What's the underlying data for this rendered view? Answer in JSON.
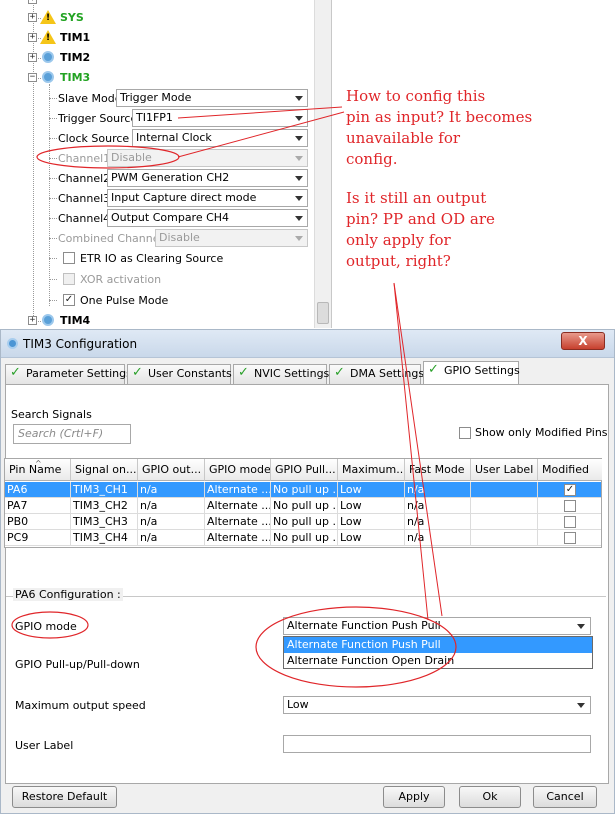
{
  "tree": {
    "items": [
      {
        "label": "SYS",
        "icon": "warning-icon",
        "color": "#22a322"
      },
      {
        "label": "TIM1",
        "icon": "warning-icon",
        "color": "#000000"
      },
      {
        "label": "TIM2",
        "icon": "gear-icon",
        "color": "#000000"
      },
      {
        "label": "TIM3",
        "icon": "gear-icon",
        "color": "#22a322"
      },
      {
        "label": "TIM4",
        "icon": "gear-icon",
        "color": "#000000"
      }
    ],
    "tim3_props": [
      {
        "label": "Slave Mode",
        "value": "Trigger Mode",
        "enabled": true
      },
      {
        "label": "Trigger Source",
        "value": "TI1FP1",
        "enabled": true
      },
      {
        "label": "Clock Source",
        "value": "Internal Clock",
        "enabled": true
      },
      {
        "label": "Channel1",
        "value": "Disable",
        "enabled": false
      },
      {
        "label": "Channel2",
        "value": "PWM Generation CH2",
        "enabled": true
      },
      {
        "label": "Channel3",
        "value": "Input Capture direct mode",
        "enabled": true
      },
      {
        "label": "Channel4",
        "value": "Output Compare CH4",
        "enabled": true
      },
      {
        "label": "Combined Channels",
        "value": "Disable",
        "enabled": false
      }
    ],
    "checks": [
      {
        "label": "ETR IO as Clearing Source",
        "checked": false,
        "enabled": true
      },
      {
        "label": "XOR activation",
        "checked": false,
        "enabled": false
      },
      {
        "label": "One Pulse Mode",
        "checked": true,
        "enabled": true
      }
    ]
  },
  "notes": {
    "first": [
      "How to config this",
      "pin as input?  It becomes",
      "unavailable for",
      "config."
    ],
    "second": [
      "Is it still an output",
      "pin?  PP and OD are",
      "only apply for",
      "output, right?"
    ]
  },
  "dialog": {
    "title": "TIM3 Configuration",
    "close_label": "X",
    "tabs": [
      {
        "label": "Parameter Settings"
      },
      {
        "label": "User Constants"
      },
      {
        "label": "NVIC Settings"
      },
      {
        "label": "DMA Settings"
      },
      {
        "label": "GPIO Settings",
        "active": true
      }
    ],
    "search": {
      "label": "Search Signals",
      "placeholder": "Search (Crtl+F)"
    },
    "only_modified_label": "Show only Modified Pins",
    "table": {
      "columns": [
        "Pin Name",
        "Signal on...",
        "GPIO out...",
        "GPIO mode",
        "GPIO Pull...",
        "Maximum...",
        "Fast Mode",
        "User Label",
        "Modified"
      ],
      "rows": [
        {
          "pin": "PA6",
          "signal": "TIM3_CH1",
          "gpio_out": "n/a",
          "mode": "Alternate ...",
          "pull": "No pull up ...",
          "speed": "Low",
          "fast": "n/a",
          "label": "",
          "modified": true,
          "selected": true
        },
        {
          "pin": "PA7",
          "signal": "TIM3_CH2",
          "gpio_out": "n/a",
          "mode": "Alternate ...",
          "pull": "No pull up ...",
          "speed": "Low",
          "fast": "n/a",
          "label": "",
          "modified": false,
          "selected": false
        },
        {
          "pin": "PB0",
          "signal": "TIM3_CH3",
          "gpio_out": "n/a",
          "mode": "Alternate ...",
          "pull": "No pull up ...",
          "speed": "Low",
          "fast": "n/a",
          "label": "",
          "modified": false,
          "selected": false
        },
        {
          "pin": "PC9",
          "signal": "TIM3_CH4",
          "gpio_out": "n/a",
          "mode": "Alternate ...",
          "pull": "No pull up ...",
          "speed": "Low",
          "fast": "n/a",
          "label": "",
          "modified": false,
          "selected": false
        }
      ]
    },
    "config": {
      "title": "PA6 Configuration :",
      "gpio_mode_label": "GPIO mode",
      "gpio_mode_value": "Alternate Function Push Pull",
      "gpio_mode_options": [
        "Alternate Function Push Pull",
        "Alternate Function Open Drain"
      ],
      "pull_label": "GPIO Pull-up/Pull-down",
      "speed_label": "Maximum output speed",
      "speed_value": "Low",
      "user_label_label": "User Label",
      "user_label_value": ""
    },
    "buttons": {
      "restore": "Restore Default",
      "apply": "Apply",
      "ok": "Ok",
      "cancel": "Cancel"
    }
  },
  "colors": {
    "annotation": "#e0262a",
    "selection": "#3399ff",
    "tab_check": "#2aa02a"
  }
}
